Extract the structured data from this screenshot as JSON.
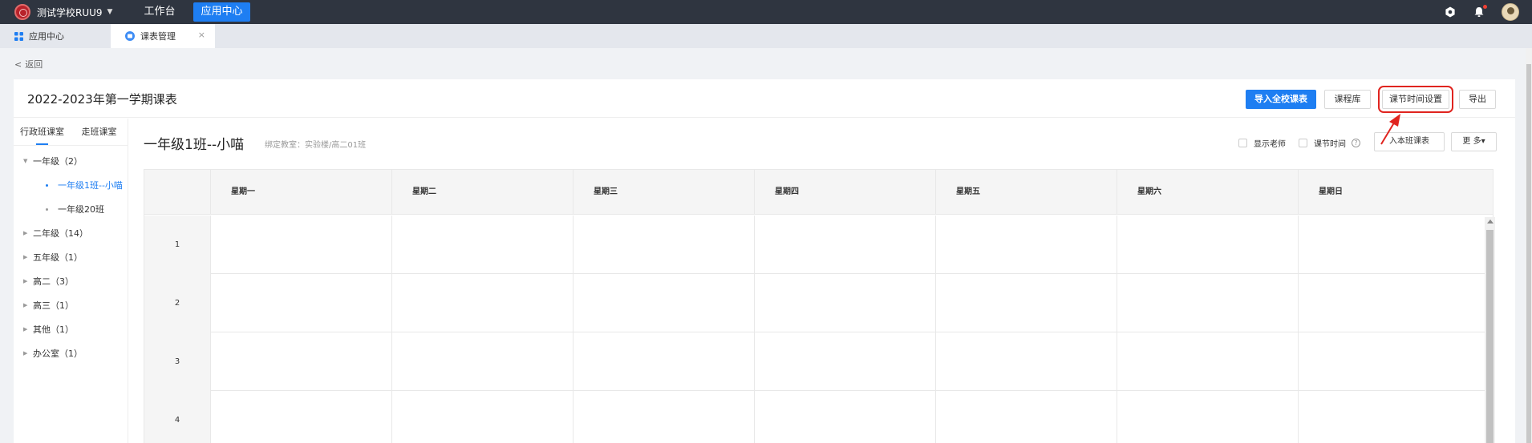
{
  "topbar": {
    "school_name": "测试学校RUU9",
    "nav": [
      {
        "label": "工作台",
        "active": false
      },
      {
        "label": "应用中心",
        "active": true
      }
    ],
    "icons": [
      "settings-icon",
      "bell-icon",
      "avatar"
    ]
  },
  "tabs": [
    {
      "label": "应用中心",
      "icon": "grid-icon",
      "active": false
    },
    {
      "label": "课表管理",
      "icon": "schedule-icon",
      "active": true,
      "close": "×"
    }
  ],
  "back": {
    "label": "返回"
  },
  "header": {
    "title": "2022-2023年第一学期课表",
    "buttons": {
      "import_all": "导入全校课表",
      "course_lib": "课程库",
      "period_time": "课节时间设置",
      "export": "导出"
    }
  },
  "sidebar": {
    "tabs": [
      {
        "label": "行政班课室",
        "active": true
      },
      {
        "label": "走班课室",
        "active": false
      }
    ],
    "tree": [
      {
        "label": "一年级（2）",
        "expanded": true,
        "level": 0
      },
      {
        "label": "一年级1班--小喵",
        "level": 1,
        "selected": true
      },
      {
        "label": "一年级20班",
        "level": 1,
        "selected": false
      },
      {
        "label": "二年级（14）",
        "level": 0
      },
      {
        "label": "五年级（1）",
        "level": 0
      },
      {
        "label": "高二（3）",
        "level": 0
      },
      {
        "label": "高三（1）",
        "level": 0
      },
      {
        "label": "其他（1）",
        "level": 0
      },
      {
        "label": "办公室（1）",
        "level": 0
      }
    ]
  },
  "content": {
    "title": "一年级1班--小喵",
    "bound_room": "绑定教室：实验楼/高二01班",
    "show_teacher": "显示老师",
    "period_time": "课节时间",
    "help": "?",
    "import_class": "导入本班课表",
    "import_class_visible": "入本班课表",
    "more": "更 多▾"
  },
  "schedule": {
    "days": [
      "星期一",
      "星期二",
      "星期三",
      "星期四",
      "星期五",
      "星期六",
      "星期日"
    ],
    "periods": [
      "1",
      "2",
      "3",
      "4"
    ]
  },
  "colors": {
    "topbar": "#2f3540",
    "primary": "#1e7ef2",
    "highlight": "#e0241f"
  }
}
